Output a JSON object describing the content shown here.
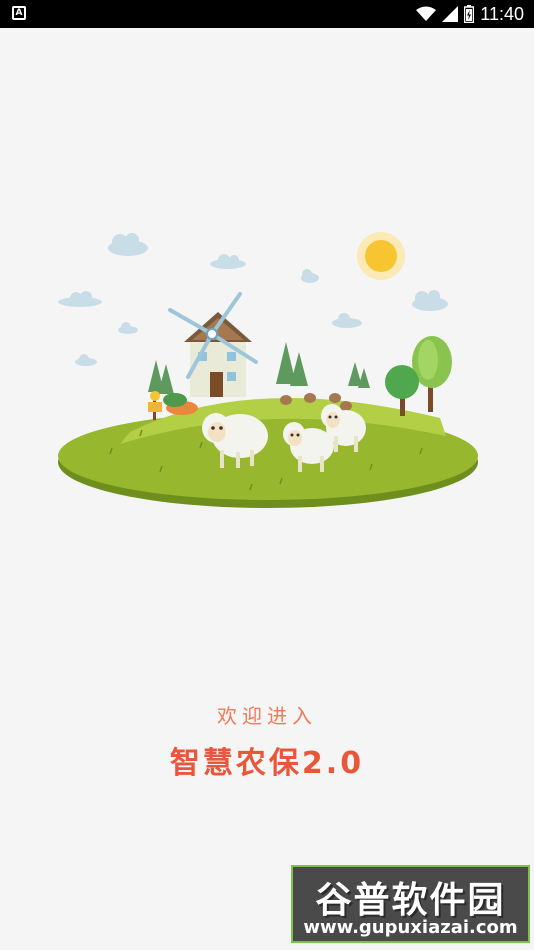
{
  "status_bar": {
    "app_icon_letter": "A",
    "time": "11:40",
    "icons": [
      "wifi-icon",
      "cell-signal-icon",
      "battery-icon"
    ]
  },
  "illustration": {
    "description_icon": "farm-scene-icon"
  },
  "splash": {
    "welcome_text": "欢迎进入",
    "app_name": "智慧农保2.0",
    "accent_color": "#e8573a"
  },
  "watermark": {
    "title": "谷普软件园",
    "url": "www.gupuxiazai.com"
  }
}
